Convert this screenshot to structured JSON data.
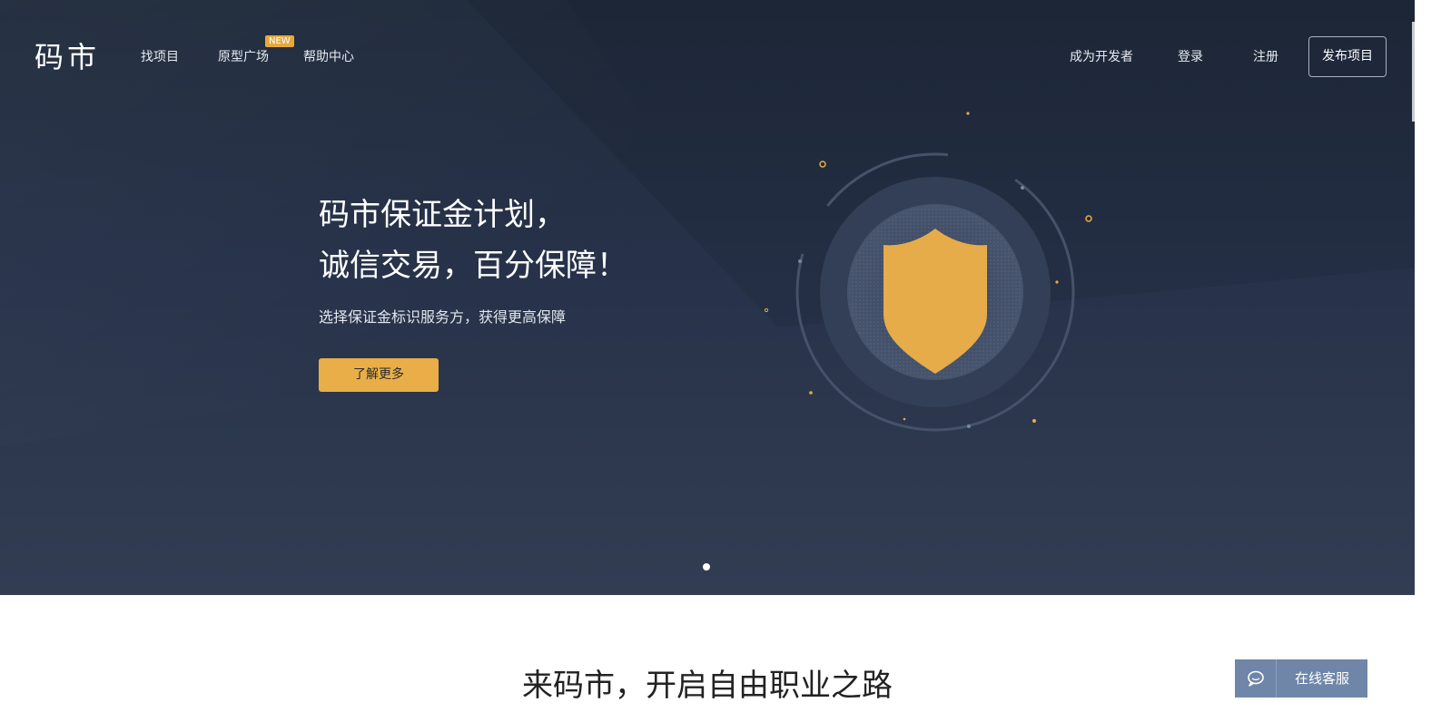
{
  "brand": {
    "logo_text": "码市"
  },
  "nav": {
    "left": [
      {
        "label": "找项目"
      },
      {
        "label": "原型广场",
        "badge": "NEW"
      },
      {
        "label": "帮助中心"
      }
    ],
    "right": [
      {
        "label": "成为开发者"
      },
      {
        "label": "登录"
      },
      {
        "label": "注册"
      }
    ],
    "publish_label": "发布项目"
  },
  "hero": {
    "title_line1": "码市保证金计划，",
    "title_line2": "诚信交易，百分保障！",
    "subtitle": "选择保证金标识服务方，获得更高保障",
    "cta_label": "了解更多",
    "carousel_count": 1,
    "carousel_active": 1
  },
  "section": {
    "title": "来码市，开启自由职业之路"
  },
  "support": {
    "label": "在线客服",
    "icon": "chat-bubble-icon"
  },
  "colors": {
    "accent": "#e9ae48",
    "hero_bg": "#27324a",
    "support_bg": "#6f86a8"
  }
}
